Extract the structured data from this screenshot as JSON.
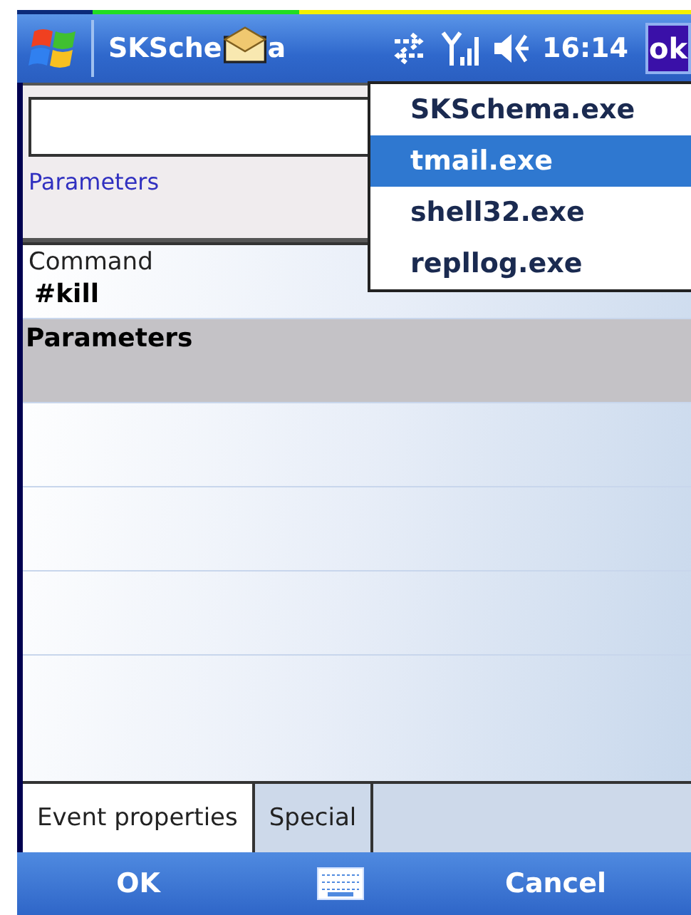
{
  "status_bar": {
    "title_start": "SKSche",
    "title_end": "a",
    "time": "16:14",
    "ok": "ok"
  },
  "process_menu": [
    {
      "label": "SKSchema.exe",
      "selected": false
    },
    {
      "label": "tmail.exe",
      "selected": true
    },
    {
      "label": "shell32.exe",
      "selected": false
    },
    {
      "label": "repllog.exe",
      "selected": false
    }
  ],
  "top_panel": {
    "link": "Parameters"
  },
  "list": {
    "header": "Command",
    "command": "#kill",
    "rows": [
      {
        "label": "Parameters",
        "selected": true
      },
      {
        "selected": false
      },
      {
        "selected": false
      },
      {
        "selected": false
      },
      {
        "selected": false
      }
    ]
  },
  "tabs": [
    {
      "label": "Event properties",
      "selected": true
    },
    {
      "label": "Special",
      "selected": false
    }
  ],
  "softkeys": {
    "left": "OK",
    "right": "Cancel"
  }
}
